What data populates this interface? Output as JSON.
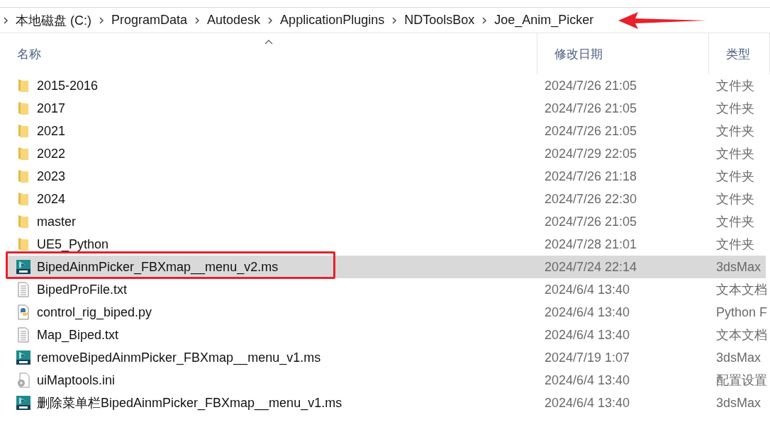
{
  "breadcrumb": {
    "items": [
      "本地磁盘 (C:)",
      "ProgramData",
      "Autodesk",
      "ApplicationPlugins",
      "NDToolsBox",
      "Joe_Anim_Picker"
    ],
    "arrow_annotation": true
  },
  "columns": [
    {
      "label": "名称",
      "sorted": true
    },
    {
      "label": "修改日期",
      "sorted": false
    },
    {
      "label": "类型",
      "sorted": false
    }
  ],
  "rows": [
    {
      "kind": "folder",
      "name": "2015-2016",
      "modified": "2024/7/26 21:05",
      "type": "文件夹",
      "selected": false,
      "outlined": false
    },
    {
      "kind": "folder",
      "name": "2017",
      "modified": "2024/7/26 21:05",
      "type": "文件夹",
      "selected": false,
      "outlined": false
    },
    {
      "kind": "folder",
      "name": "2021",
      "modified": "2024/7/26 21:05",
      "type": "文件夹",
      "selected": false,
      "outlined": false
    },
    {
      "kind": "folder",
      "name": "2022",
      "modified": "2024/7/29 22:05",
      "type": "文件夹",
      "selected": false,
      "outlined": false
    },
    {
      "kind": "folder",
      "name": "2023",
      "modified": "2024/7/26 21:18",
      "type": "文件夹",
      "selected": false,
      "outlined": false
    },
    {
      "kind": "folder",
      "name": "2024",
      "modified": "2024/7/26 22:30",
      "type": "文件夹",
      "selected": false,
      "outlined": false
    },
    {
      "kind": "folder",
      "name": "master",
      "modified": "2024/7/26 21:05",
      "type": "文件夹",
      "selected": false,
      "outlined": false
    },
    {
      "kind": "folder",
      "name": "UE5_Python",
      "modified": "2024/7/28 21:01",
      "type": "文件夹",
      "selected": false,
      "outlined": false
    },
    {
      "kind": "script",
      "name": "BipedAinmPicker_FBXmap__menu_v2.ms",
      "modified": "2024/7/24 22:14",
      "type": "3dsMax",
      "selected": true,
      "outlined": true
    },
    {
      "kind": "text",
      "name": "BipedProFile.txt",
      "modified": "2024/6/4 13:40",
      "type": "文本文档",
      "selected": false,
      "outlined": false
    },
    {
      "kind": "python",
      "name": "control_rig_biped.py",
      "modified": "2024/6/4 13:40",
      "type": "Python F",
      "selected": false,
      "outlined": false
    },
    {
      "kind": "text",
      "name": "Map_Biped.txt",
      "modified": "2024/6/4 13:40",
      "type": "文本文档",
      "selected": false,
      "outlined": false
    },
    {
      "kind": "script",
      "name": "removeBipedAinmPicker_FBXmap__menu_v1.ms",
      "modified": "2024/7/19 1:07",
      "type": "3dsMax",
      "selected": false,
      "outlined": false
    },
    {
      "kind": "settings",
      "name": "uiMaptools.ini",
      "modified": "2024/6/4 13:40",
      "type": "配置设置",
      "selected": false,
      "outlined": false
    },
    {
      "kind": "script",
      "name": "删除菜单栏BipedAinmPicker_FBXmap__menu_v1.ms",
      "modified": "2024/6/4 13:40",
      "type": "3dsMax",
      "selected": false,
      "outlined": false
    }
  ]
}
